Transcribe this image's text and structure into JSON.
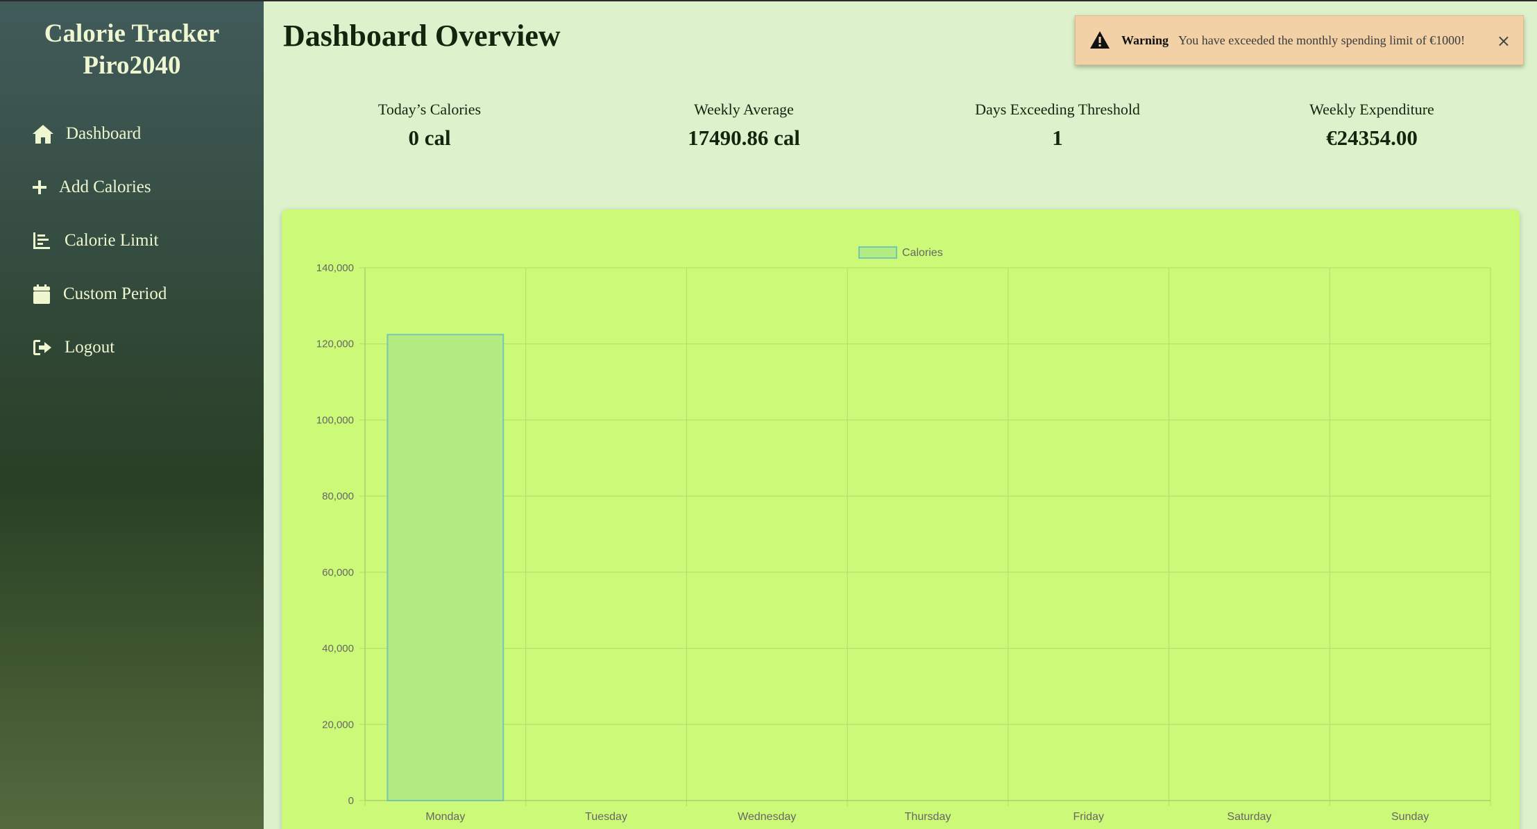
{
  "sidebar": {
    "brand_line1": "Calorie Tracker",
    "brand_line2": "Piro2040",
    "items": [
      {
        "label": "Dashboard",
        "icon": "home-icon"
      },
      {
        "label": "Add Calories",
        "icon": "plus-icon"
      },
      {
        "label": "Calorie Limit",
        "icon": "chart-icon"
      },
      {
        "label": "Custom Period",
        "icon": "calendar-icon"
      },
      {
        "label": "Logout",
        "icon": "logout-icon"
      }
    ]
  },
  "main": {
    "title": "Dashboard Overview",
    "stats": [
      {
        "label": "Today’s Calories",
        "value": "0 cal"
      },
      {
        "label": "Weekly Average",
        "value": "17490.86 cal"
      },
      {
        "label": "Days Exceeding Threshold",
        "value": "1"
      },
      {
        "label": "Weekly Expenditure",
        "value": "€24354.00"
      }
    ]
  },
  "toast": {
    "title": "Warning",
    "message": "You have exceeded the monthly spending limit of €1000!",
    "close": "×"
  },
  "colors": {
    "card_bg": "#ccfa78",
    "bar_fill": "#b4ec84",
    "bar_border": "#73c6b0",
    "grid": "#b2dc6a"
  },
  "chart_data": {
    "type": "bar",
    "categories": [
      "Monday",
      "Tuesday",
      "Wednesday",
      "Thursday",
      "Friday",
      "Saturday",
      "Sunday"
    ],
    "series": [
      {
        "name": "Calories",
        "values": [
          122436,
          0,
          0,
          0,
          0,
          0,
          0
        ]
      }
    ],
    "ylim": [
      0,
      140000
    ],
    "yticks": [
      0,
      20000,
      40000,
      60000,
      80000,
      100000,
      120000,
      140000
    ],
    "ytick_labels": [
      "0",
      "20,000",
      "40,000",
      "60,000",
      "80,000",
      "100,000",
      "120,000",
      "140,000"
    ],
    "grid": true,
    "legend": "top-center"
  }
}
